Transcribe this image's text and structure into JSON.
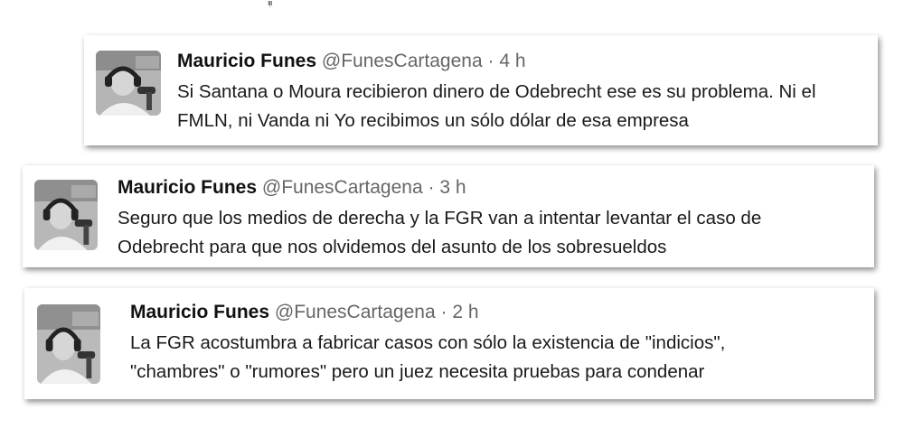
{
  "tweets": [
    {
      "name": "Mauricio Funes",
      "handle": "@FunesCartagena",
      "separator": "·",
      "time": "4 h",
      "lines": [
        "Si Santana o Moura recibieron dinero de Odebrecht ese es su problema. Ni el",
        "FMLN, ni Vanda ni Yo recibimos un sólo dólar de esa empresa"
      ]
    },
    {
      "name": "Mauricio Funes",
      "handle": "@FunesCartagena",
      "separator": "·",
      "time": "3 h",
      "lines": [
        "Seguro que los medios de derecha y la FGR van a intentar levantar el caso de",
        "Odebrecht para que nos olvidemos del asunto de los sobresueldos"
      ]
    },
    {
      "name": "Mauricio Funes",
      "handle": "@FunesCartagena",
      "separator": "·",
      "time": "2 h",
      "lines": [
        "La FGR acostumbra a fabricar casos con sólo la existencia de \"indicios\",",
        "\"chambres\" o \"rumores\" pero un juez necesita pruebas para condenar"
      ]
    }
  ]
}
